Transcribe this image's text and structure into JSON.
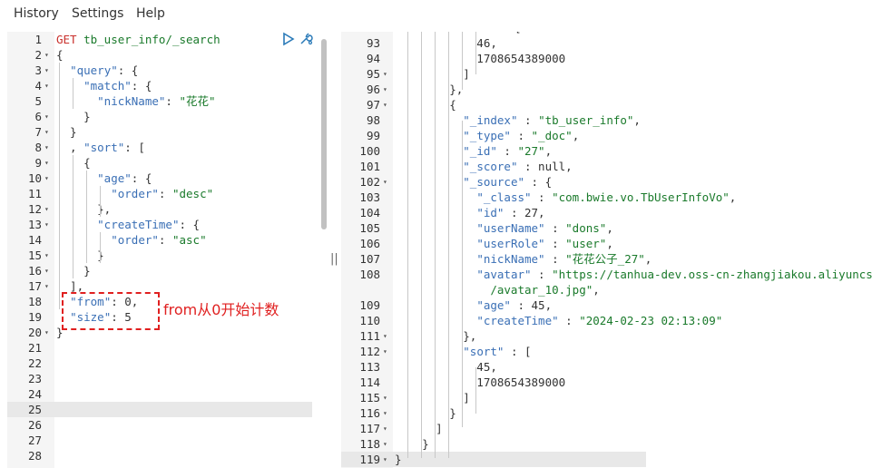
{
  "menu": [
    "History",
    "Settings",
    "Help"
  ],
  "request": {
    "lines": [
      {
        "n": "1",
        "t": [
          [
            "verb",
            "GET "
          ],
          [
            "url",
            "tb_user_info/_search"
          ]
        ]
      },
      {
        "n": "2",
        "f": true,
        "t": [
          [
            "p",
            "{"
          ]
        ]
      },
      {
        "n": "3",
        "f": true,
        "t": [
          [
            "p",
            "  "
          ],
          [
            "key",
            "\"query\""
          ],
          [
            "p",
            ": {"
          ]
        ]
      },
      {
        "n": "4",
        "f": true,
        "t": [
          [
            "p",
            "    "
          ],
          [
            "key",
            "\"match\""
          ],
          [
            "p",
            ": {"
          ]
        ]
      },
      {
        "n": "5",
        "t": [
          [
            "p",
            "      "
          ],
          [
            "key",
            "\"nickName\""
          ],
          [
            "p",
            ": "
          ],
          [
            "str",
            "\"花花\""
          ]
        ]
      },
      {
        "n": "6",
        "f": true,
        "t": [
          [
            "p",
            "    }"
          ]
        ]
      },
      {
        "n": "7",
        "f": true,
        "t": [
          [
            "p",
            "  }"
          ]
        ]
      },
      {
        "n": "8",
        "f": true,
        "t": [
          [
            "p",
            "  , "
          ],
          [
            "key",
            "\"sort\""
          ],
          [
            "p",
            ": ["
          ]
        ]
      },
      {
        "n": "9",
        "f": true,
        "t": [
          [
            "p",
            "    {"
          ]
        ]
      },
      {
        "n": "10",
        "f": true,
        "t": [
          [
            "p",
            "      "
          ],
          [
            "key",
            "\"age\""
          ],
          [
            "p",
            ": {"
          ]
        ]
      },
      {
        "n": "11",
        "t": [
          [
            "p",
            "        "
          ],
          [
            "key",
            "\"order\""
          ],
          [
            "p",
            ": "
          ],
          [
            "str",
            "\"desc\""
          ]
        ]
      },
      {
        "n": "12",
        "f": true,
        "t": [
          [
            "p",
            "      },"
          ]
        ]
      },
      {
        "n": "13",
        "f": true,
        "t": [
          [
            "p",
            "      "
          ],
          [
            "key",
            "\"createTime\""
          ],
          [
            "p",
            ": {"
          ]
        ]
      },
      {
        "n": "14",
        "t": [
          [
            "p",
            "        "
          ],
          [
            "key",
            "\"order\""
          ],
          [
            "p",
            ": "
          ],
          [
            "str",
            "\"asc\""
          ]
        ]
      },
      {
        "n": "15",
        "f": true,
        "t": [
          [
            "p",
            "      }"
          ]
        ]
      },
      {
        "n": "16",
        "f": true,
        "t": [
          [
            "p",
            "    }"
          ]
        ]
      },
      {
        "n": "17",
        "f": true,
        "t": [
          [
            "p",
            "  ],"
          ]
        ]
      },
      {
        "n": "18",
        "t": [
          [
            "p",
            "  "
          ],
          [
            "key",
            "\"from\""
          ],
          [
            "p",
            ": 0,"
          ]
        ]
      },
      {
        "n": "19",
        "t": [
          [
            "p",
            "  "
          ],
          [
            "key",
            "\"size\""
          ],
          [
            "p",
            ": 5"
          ]
        ]
      },
      {
        "n": "20",
        "f": true,
        "t": [
          [
            "p",
            "}"
          ]
        ]
      },
      {
        "n": "21",
        "t": []
      },
      {
        "n": "22",
        "t": []
      },
      {
        "n": "23",
        "t": []
      },
      {
        "n": "24",
        "t": []
      },
      {
        "n": "25",
        "t": []
      },
      {
        "n": "26",
        "t": []
      },
      {
        "n": "27",
        "t": []
      },
      {
        "n": "28",
        "t": []
      }
    ],
    "active_line": "25"
  },
  "annotation": "from从0开始计数",
  "response": {
    "lines": [
      {
        "n": "93",
        "t": [
          [
            "p",
            "            46,"
          ]
        ]
      },
      {
        "n": "94",
        "t": [
          [
            "p",
            "            1708654389000"
          ]
        ]
      },
      {
        "n": "95",
        "f": true,
        "t": [
          [
            "p",
            "          ]"
          ]
        ]
      },
      {
        "n": "96",
        "f": true,
        "t": [
          [
            "p",
            "        },"
          ]
        ]
      },
      {
        "n": "97",
        "f": true,
        "t": [
          [
            "p",
            "        {"
          ]
        ]
      },
      {
        "n": "98",
        "t": [
          [
            "p",
            "          "
          ],
          [
            "key",
            "\"_index\""
          ],
          [
            "p",
            " : "
          ],
          [
            "str",
            "\"tb_user_info\""
          ],
          [
            "p",
            ","
          ]
        ]
      },
      {
        "n": "99",
        "t": [
          [
            "p",
            "          "
          ],
          [
            "key",
            "\"_type\""
          ],
          [
            "p",
            " : "
          ],
          [
            "str",
            "\"_doc\""
          ],
          [
            "p",
            ","
          ]
        ]
      },
      {
        "n": "100",
        "t": [
          [
            "p",
            "          "
          ],
          [
            "key",
            "\"_id\""
          ],
          [
            "p",
            " : "
          ],
          [
            "str",
            "\"27\""
          ],
          [
            "p",
            ","
          ]
        ]
      },
      {
        "n": "101",
        "t": [
          [
            "p",
            "          "
          ],
          [
            "key",
            "\"_score\""
          ],
          [
            "p",
            " : null,"
          ]
        ]
      },
      {
        "n": "102",
        "f": true,
        "t": [
          [
            "p",
            "          "
          ],
          [
            "key",
            "\"_source\""
          ],
          [
            "p",
            " : {"
          ]
        ]
      },
      {
        "n": "103",
        "t": [
          [
            "p",
            "            "
          ],
          [
            "key",
            "\"_class\""
          ],
          [
            "p",
            " : "
          ],
          [
            "str",
            "\"com.bwie.vo.TbUserInfoVo\""
          ],
          [
            "p",
            ","
          ]
        ]
      },
      {
        "n": "104",
        "t": [
          [
            "p",
            "            "
          ],
          [
            "key",
            "\"id\""
          ],
          [
            "p",
            " : 27,"
          ]
        ]
      },
      {
        "n": "105",
        "t": [
          [
            "p",
            "            "
          ],
          [
            "key",
            "\"userName\""
          ],
          [
            "p",
            " : "
          ],
          [
            "str",
            "\"dons\""
          ],
          [
            "p",
            ","
          ]
        ]
      },
      {
        "n": "106",
        "t": [
          [
            "p",
            "            "
          ],
          [
            "key",
            "\"userRole\""
          ],
          [
            "p",
            " : "
          ],
          [
            "str",
            "\"user\""
          ],
          [
            "p",
            ","
          ]
        ]
      },
      {
        "n": "107",
        "t": [
          [
            "p",
            "            "
          ],
          [
            "key",
            "\"nickName\""
          ],
          [
            "p",
            " : "
          ],
          [
            "str",
            "\"花花公子_27\""
          ],
          [
            "p",
            ","
          ]
        ]
      },
      {
        "n": "108",
        "t": [
          [
            "p",
            "            "
          ],
          [
            "key",
            "\"avatar\""
          ],
          [
            "p",
            " : "
          ],
          [
            "str",
            "\"https://tanhua-dev.oss-cn-zhangjiakou.aliyuncs."
          ]
        ]
      },
      {
        "n": "",
        "t": [
          [
            "str",
            "              /avatar_10.jpg\""
          ],
          [
            "p",
            ","
          ]
        ]
      },
      {
        "n": "109",
        "t": [
          [
            "p",
            "            "
          ],
          [
            "key",
            "\"age\""
          ],
          [
            "p",
            " : 45,"
          ]
        ]
      },
      {
        "n": "110",
        "t": [
          [
            "p",
            "            "
          ],
          [
            "key",
            "\"createTime\""
          ],
          [
            "p",
            " : "
          ],
          [
            "str",
            "\"2024-02-23 02:13:09\""
          ]
        ]
      },
      {
        "n": "111",
        "f": true,
        "t": [
          [
            "p",
            "          },"
          ]
        ]
      },
      {
        "n": "112",
        "f": true,
        "t": [
          [
            "p",
            "          "
          ],
          [
            "key",
            "\"sort\""
          ],
          [
            "p",
            " : ["
          ]
        ]
      },
      {
        "n": "113",
        "t": [
          [
            "p",
            "            45,"
          ]
        ]
      },
      {
        "n": "114",
        "t": [
          [
            "p",
            "            1708654389000"
          ]
        ]
      },
      {
        "n": "115",
        "f": true,
        "t": [
          [
            "p",
            "          ]"
          ]
        ]
      },
      {
        "n": "116",
        "f": true,
        "t": [
          [
            "p",
            "        }"
          ]
        ]
      },
      {
        "n": "117",
        "f": true,
        "t": [
          [
            "p",
            "      ]"
          ]
        ]
      },
      {
        "n": "118",
        "f": true,
        "t": [
          [
            "p",
            "    }"
          ]
        ]
      },
      {
        "n": "119",
        "f": true,
        "t": [
          [
            "p",
            "}"
          ]
        ]
      }
    ],
    "partial_top": "[",
    "active_line": "119"
  },
  "icons": [
    "play-icon",
    "wrench-icon",
    "fold-arrow-icon",
    "resize-handle-icon"
  ],
  "colors": {
    "key": "#3a6fb5",
    "string": "#1a7a2b",
    "verb": "#c9302c",
    "annotation": "#e02020"
  }
}
